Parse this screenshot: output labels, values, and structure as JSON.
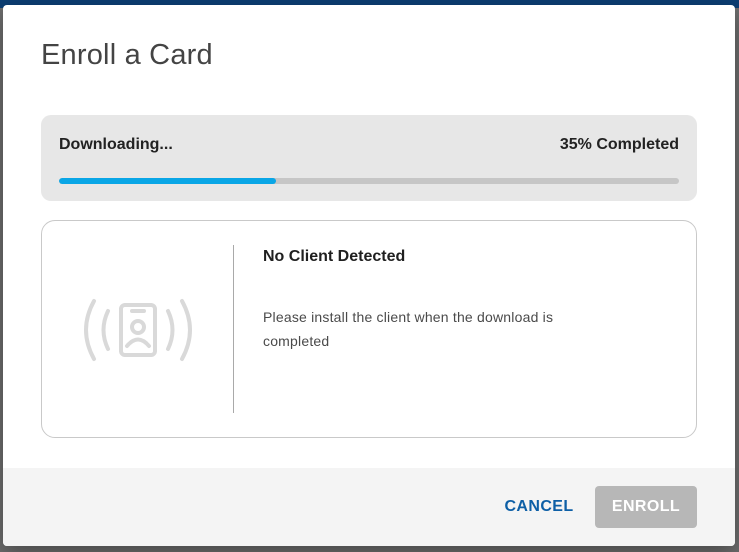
{
  "dialog": {
    "title": "Enroll a Card"
  },
  "progress": {
    "status": "Downloading...",
    "percent_label": "35% Completed",
    "fraction": 0.35,
    "fill_color": "#0aa6e6",
    "track_color": "#c6c6c6"
  },
  "client": {
    "icon": "contactless-id-card-icon",
    "title": "No Client Detected",
    "message": "Please install the client when the download is completed"
  },
  "footer": {
    "cancel_label": "CANCEL",
    "enroll_label": "ENROLL",
    "enroll_disabled": true
  },
  "colors": {
    "accent": "#0d5fa6",
    "header_bar": "#0c3e73"
  }
}
